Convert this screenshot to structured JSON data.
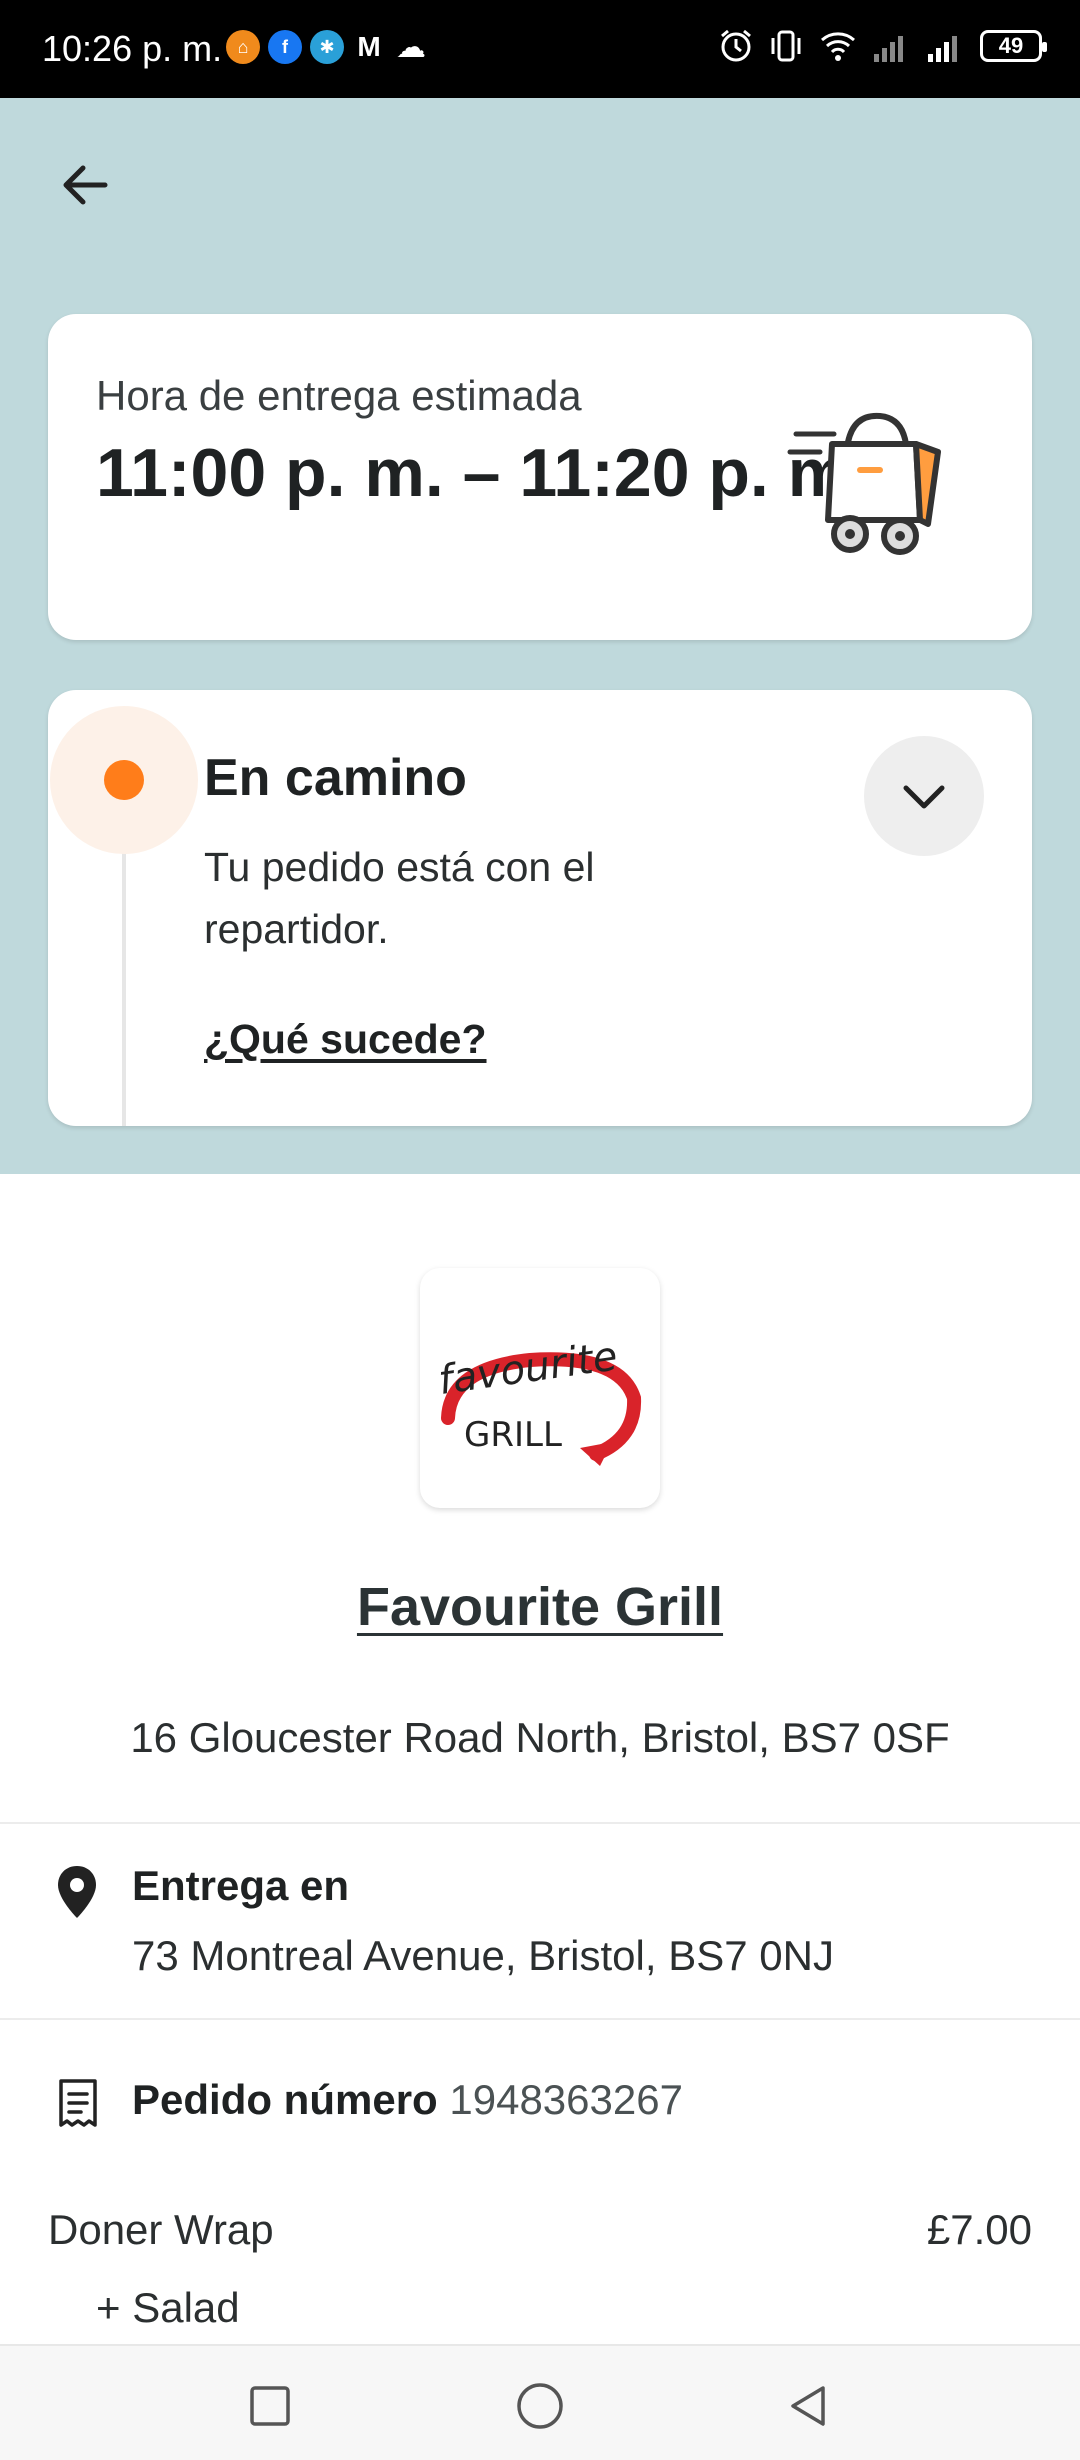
{
  "status_bar": {
    "time": "10:26 p. m.",
    "battery": "49",
    "apps": [
      "ali-app-icon",
      "facebook-icon",
      "browser-icon",
      "gmail-icon",
      "cloud-icon"
    ]
  },
  "header": {
    "back_icon": "arrow-left-icon"
  },
  "eta": {
    "label": "Hora de entrega estimada",
    "time": "11:00 p. m. – 11:20 p. m.",
    "illustration": "delivery-cart-icon"
  },
  "status": {
    "title": "En camino",
    "description": "Tu pedido está con el repartidor.",
    "link": "¿Qué sucede?",
    "accent_color": "#ff7d1a"
  },
  "restaurant": {
    "logo_top": "favourite",
    "logo_bottom": "GRILL",
    "name": "Favourite Grill",
    "address": "16 Gloucester Road North, Bristol, BS7 0SF"
  },
  "delivery": {
    "label": "Entrega en",
    "address": "73 Montreal Avenue, Bristol, BS7 0NJ"
  },
  "order": {
    "label": "Pedido número",
    "number": "1948363267",
    "items": [
      {
        "name": "Doner Wrap",
        "price": "£7.00",
        "modifiers": [
          "+ Salad"
        ]
      }
    ]
  },
  "colors": {
    "header_bg": "#bfd9dc",
    "accent": "#ff7d1a"
  }
}
